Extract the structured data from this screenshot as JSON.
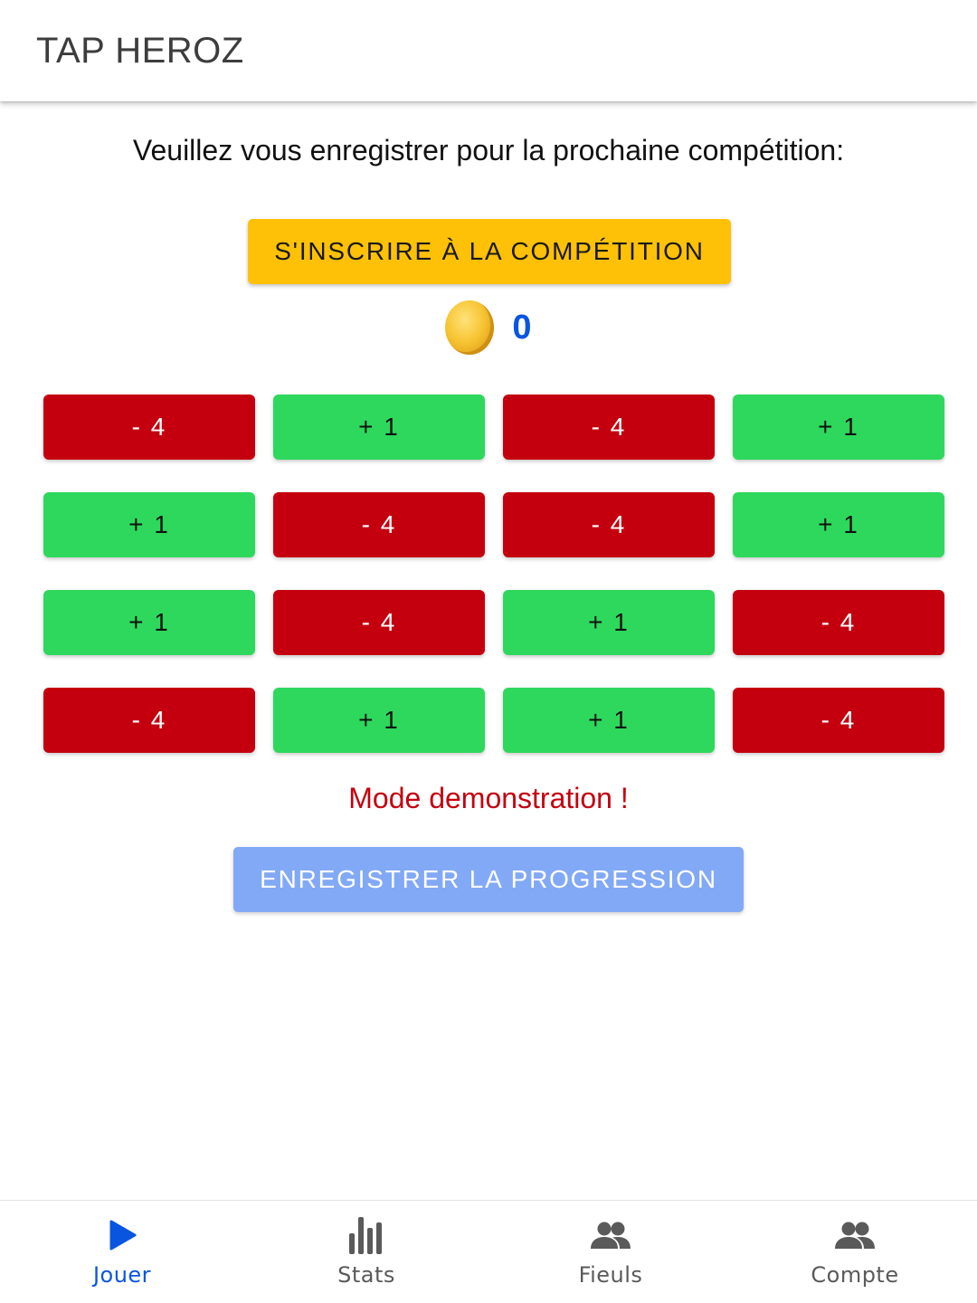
{
  "app": {
    "title": "TAP HEROZ"
  },
  "prompt": "Veuillez vous enregistrer pour la prochaine compétition:",
  "register_button": "S'INSCRIRE À LA COMPÉTITION",
  "coins": {
    "icon": "coin-icon",
    "count": "0"
  },
  "tiles": [
    {
      "label": "- 4",
      "type": "neg"
    },
    {
      "label": "+ 1",
      "type": "pos"
    },
    {
      "label": "- 4",
      "type": "neg"
    },
    {
      "label": "+ 1",
      "type": "pos"
    },
    {
      "label": "+ 1",
      "type": "pos"
    },
    {
      "label": "- 4",
      "type": "neg"
    },
    {
      "label": "- 4",
      "type": "neg"
    },
    {
      "label": "+ 1",
      "type": "pos"
    },
    {
      "label": "+ 1",
      "type": "pos"
    },
    {
      "label": "- 4",
      "type": "neg"
    },
    {
      "label": "+ 1",
      "type": "pos"
    },
    {
      "label": "- 4",
      "type": "neg"
    },
    {
      "label": "- 4",
      "type": "neg"
    },
    {
      "label": "+ 1",
      "type": "pos"
    },
    {
      "label": "+ 1",
      "type": "pos"
    },
    {
      "label": "- 4",
      "type": "neg"
    }
  ],
  "demo_text": "Mode demonstration !",
  "save_button": "ENREGISTRER LA PROGRESSION",
  "nav": [
    {
      "label": "Jouer",
      "icon": "play-icon",
      "active": true
    },
    {
      "label": "Stats",
      "icon": "bar-chart-icon",
      "active": false
    },
    {
      "label": "Fieuls",
      "icon": "people-icon",
      "active": false
    },
    {
      "label": "Compte",
      "icon": "people-icon",
      "active": false
    }
  ],
  "colors": {
    "accent_yellow": "#ffc107",
    "negative": "#c4000f",
    "positive": "#2ed85c",
    "primary_blue": "#0a55e0",
    "save_button": "#82a9f5"
  }
}
